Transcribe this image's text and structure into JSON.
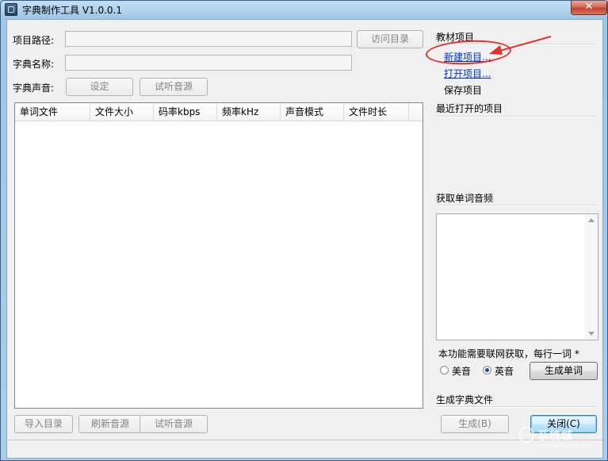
{
  "window": {
    "title": "字典制作工具 V1.0.0.1",
    "close_label": "✕"
  },
  "form": {
    "project_path_label": "项目路径:",
    "dict_name_label": "字典名称:",
    "dict_sound_label": "字典声音:",
    "visit_dir_button": "访问目录",
    "setup_button": "设定",
    "preview_sound_button": "试听音源"
  },
  "table": {
    "columns": [
      "单词文件",
      "文件大小",
      "码率kbps",
      "频率kHz",
      "声音模式",
      "文件时长"
    ],
    "rows": []
  },
  "bottom_buttons": {
    "import_dir": "导入目录",
    "refresh_source": "刷新音源",
    "preview_source": "试听音源"
  },
  "sidebar": {
    "project_section": "教材项目",
    "new_project": "新建项目...",
    "open_project": "打开项目...",
    "save_project": "保存项目",
    "recent_section": "最近打开的项目",
    "fetch_section": "获取单词音频",
    "note": "本功能需要联网获取，每行一词 *",
    "radio_us": "美音",
    "radio_uk": "英音",
    "selected_accent": "英音",
    "generate_words_button": "生成单词",
    "gen_dict_section": "生成字典文件",
    "generate_button": "生成(B)",
    "close_button": "关闭(C)"
  },
  "watermark": {
    "text": "系统城",
    "sub": "xitongcheng.com"
  },
  "colors": {
    "link": "#0033cc",
    "annotation_red": "#e0322c",
    "titlebar": "#a9cdea"
  }
}
